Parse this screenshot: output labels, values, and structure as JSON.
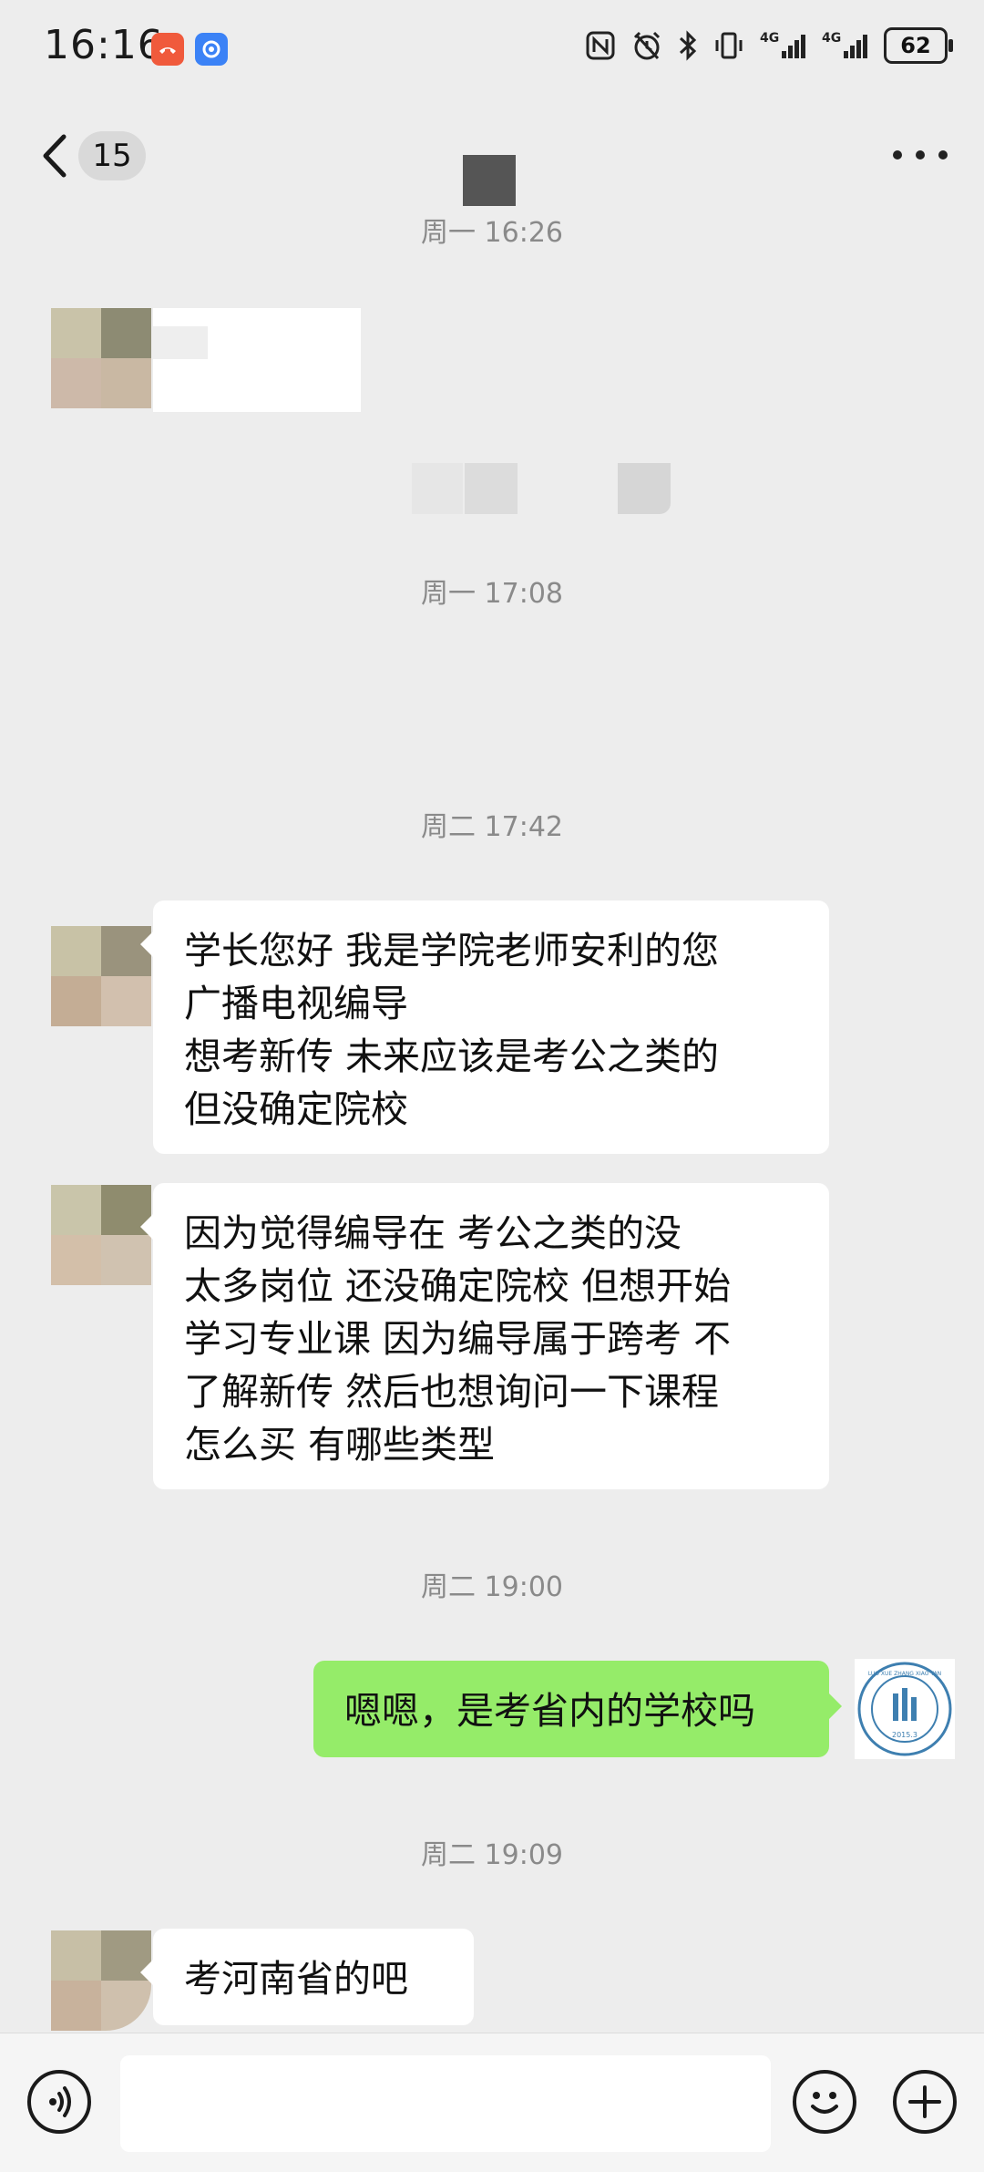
{
  "status_bar": {
    "time": "16:16",
    "battery": "62",
    "icons": [
      "nfc-icon",
      "alarm-icon",
      "bluetooth-icon",
      "vibrate-icon",
      "signal-4g-icon",
      "signal-4g-2-icon",
      "battery-icon"
    ]
  },
  "nav": {
    "unread_count": "15",
    "icons": [
      "back-arrow-icon",
      "more-icon"
    ]
  },
  "messages": {
    "ts1": "周一 16:26",
    "ts2": "周一 17:08",
    "ts3": "周二 17:42",
    "msg1": "学长您好 我是学院老师安利的您\n广播电视编导\n想考新传  未来应该是考公之类的\n但没确定院校",
    "msg2": "因为觉得编导在        考公之类的没\n太多岗位  还没确定院校 但想开始\n学习专业课  因为编导属于跨考  不\n了解新传  然后也想询问一下课程\n怎么买 有哪些类型",
    "ts4": "周二 19:00",
    "msg3": "嗯嗯，是考省内的学校吗",
    "ts5": "周二 19:09",
    "msg4": "考河南省的吧"
  },
  "self_avatar": {
    "seal_text": "LUO XUE ZHANG XIAO YAN",
    "seal_date": "2015.3"
  },
  "input_bar": {
    "placeholder": "",
    "icons": [
      "voice-icon",
      "emoji-icon",
      "plus-icon"
    ]
  },
  "colors": {
    "background": "#ededed",
    "bubble_self": "#95ec69",
    "bubble_other": "#ffffff"
  }
}
